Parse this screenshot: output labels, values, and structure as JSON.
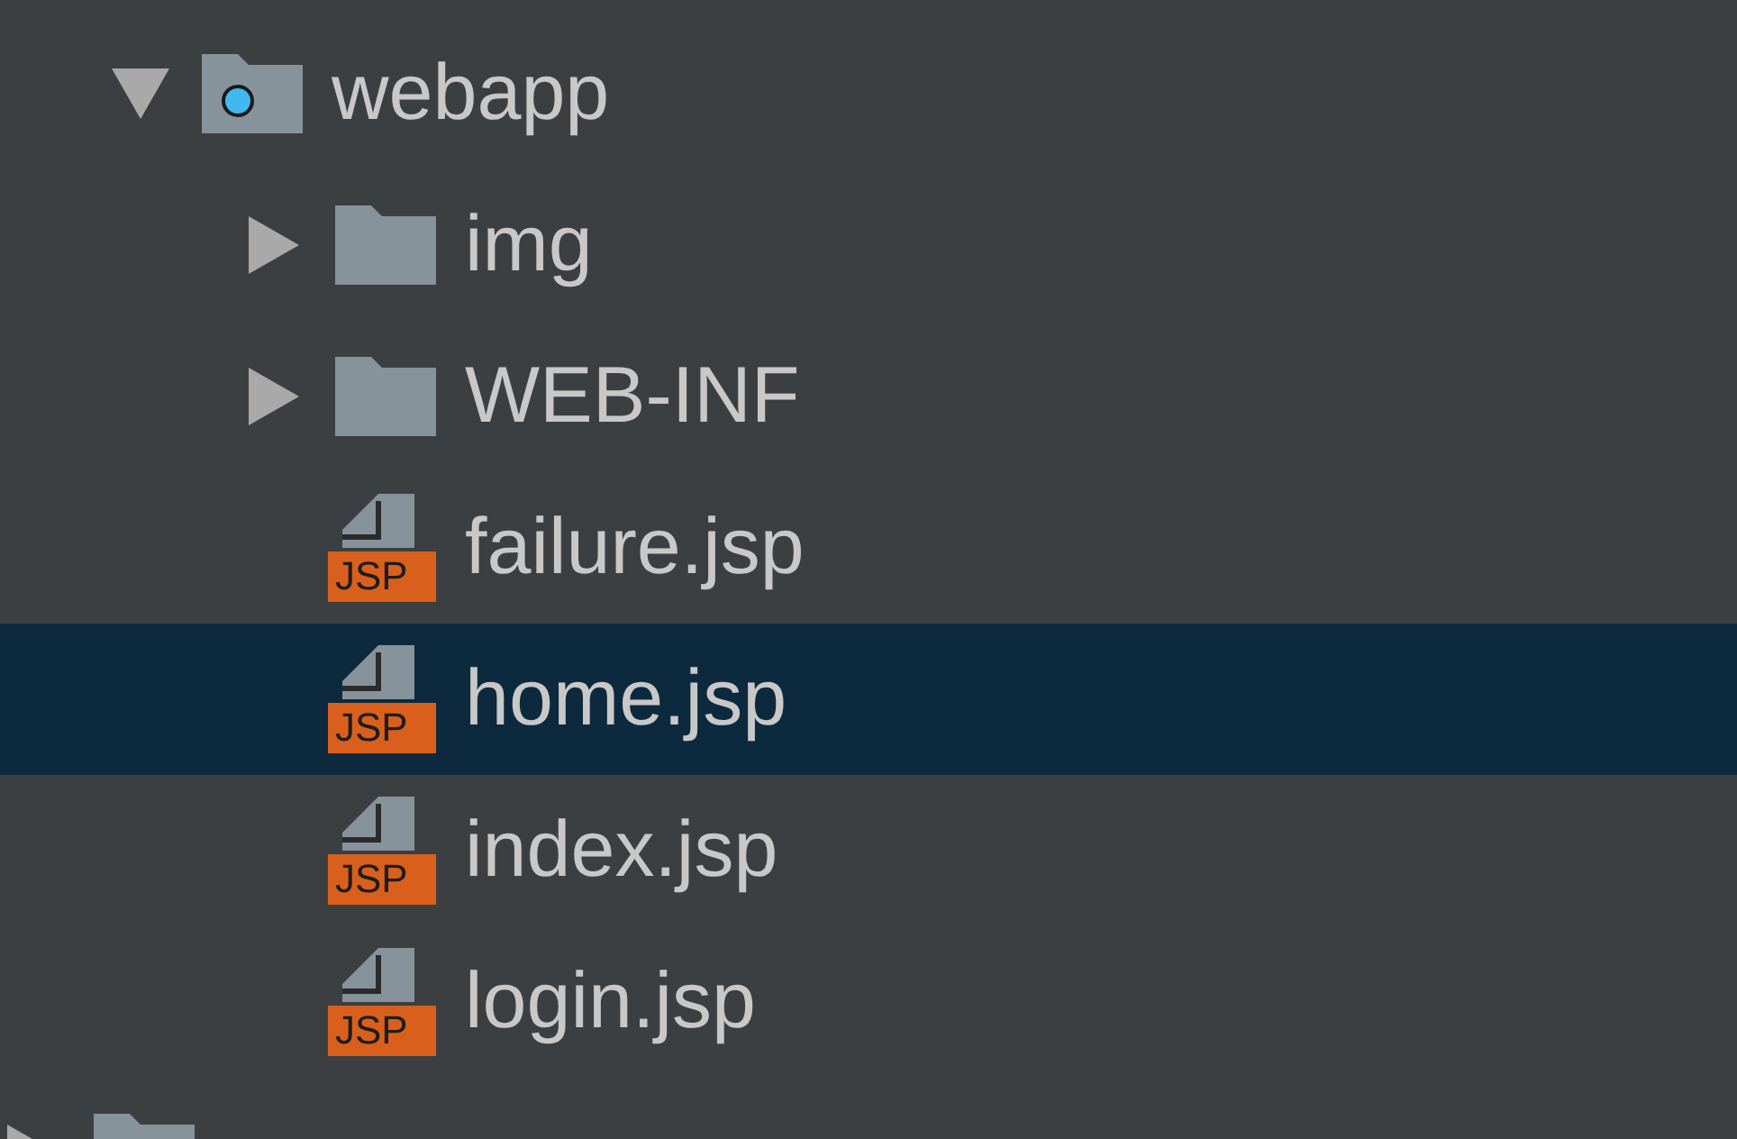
{
  "tree": [
    {
      "kind": "source-folder",
      "label": "webapp",
      "expanded": true,
      "selected": false,
      "children": [
        {
          "kind": "folder",
          "label": "img",
          "expanded": false,
          "selected": false
        },
        {
          "kind": "folder",
          "label": "WEB-INF",
          "expanded": false,
          "selected": false
        },
        {
          "kind": "jsp",
          "label": "failure.jsp",
          "badge": "JSP",
          "selected": false
        },
        {
          "kind": "jsp",
          "label": "home.jsp",
          "badge": "JSP",
          "selected": true
        },
        {
          "kind": "jsp",
          "label": "index.jsp",
          "badge": "JSP",
          "selected": false
        },
        {
          "kind": "jsp",
          "label": "login.jsp",
          "badge": "JSP",
          "selected": false
        }
      ]
    },
    {
      "kind": "folder",
      "expanded": false,
      "selected": false
    }
  ]
}
